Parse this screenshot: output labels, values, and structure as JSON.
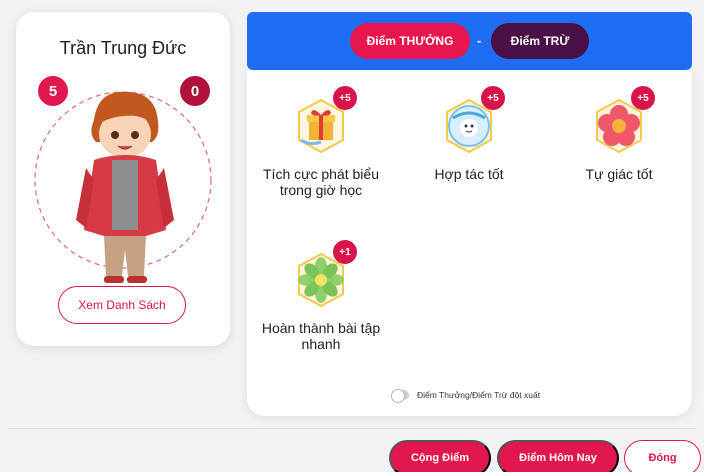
{
  "student": {
    "name": "Trần Trung Đức",
    "plus_points": "5",
    "minus_points": "0",
    "list_button": "Xem Danh Sách"
  },
  "tabs": {
    "reward": "Điểm THƯỞNG",
    "separator": "-",
    "penalty": "Điểm TRỪ"
  },
  "criteria": [
    {
      "label": "Tích cực phát biểu trong giờ học",
      "points": "+5",
      "icon": "gift-icon"
    },
    {
      "label": "Hợp tác tốt",
      "points": "+5",
      "icon": "cooperation-badge-icon"
    },
    {
      "label": "Tự giác tốt",
      "points": "+5",
      "icon": "flower-icon"
    },
    {
      "label": "Hoàn thành bài tập nhanh",
      "points": "+1",
      "icon": "green-flower-icon"
    }
  ],
  "toggle": {
    "label": "Điểm Thưởng/Điểm Trừ đột xuất",
    "on": false
  },
  "footer": {
    "add_points": "Cộng Điểm",
    "today_points": "Điểm Hôm Nay",
    "close": "Đóng"
  },
  "colors": {
    "primary_red": "#e0184d",
    "penalty_purple": "#4a1149",
    "tab_blue": "#1f6df2"
  }
}
